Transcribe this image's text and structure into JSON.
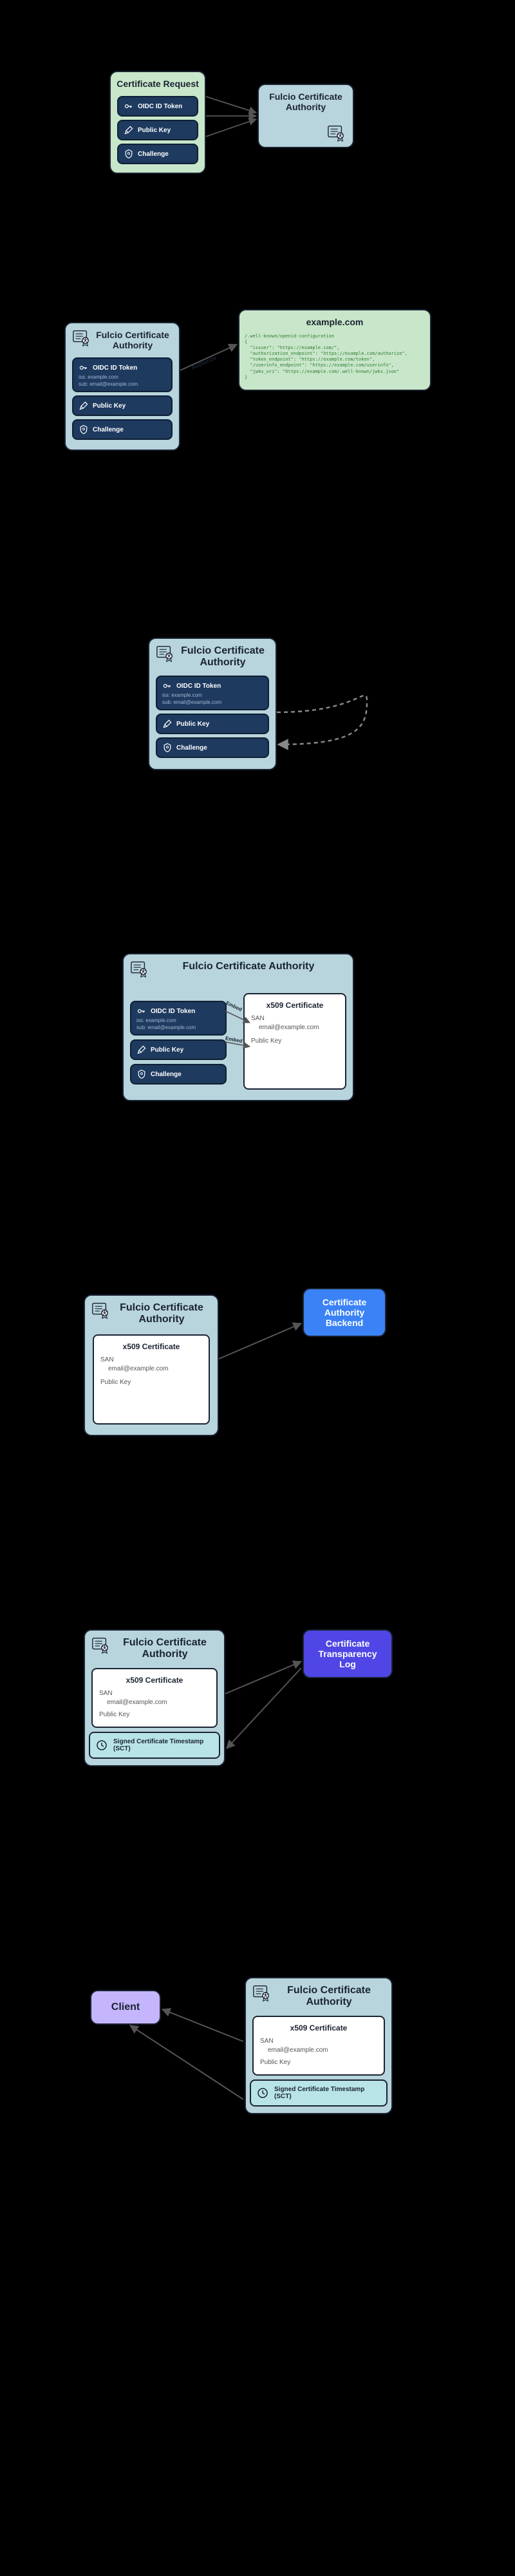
{
  "s1": {
    "req_title": "Certificate Request",
    "oidc": "OIDC ID Token",
    "pubkey": "Public Key",
    "challenge": "Challenge",
    "fca_title": "Fulcio Certificate Authority"
  },
  "s2": {
    "fca_title": "Fulcio Certificate Authority",
    "oidc": "OIDC ID Token",
    "iss": "iss: example.com",
    "sub": "sub: email@example.com",
    "pubkey": "Public Key",
    "challenge": "Challenge",
    "arrow_label": "Authorize",
    "openid_title": "example.com",
    "openid_code": "/.well-known/openid-configuration\n{\n  \"issuer\": \"https://example.com/\",\n  \"authorization_endpoint\": \"https://example.com/authorize\",\n  \"token_endpoint\": \"https://example.com/token\",\n  \"/userinfo_endpoint\": \"https://example.com/userinfo\",\n  \"jwks_uri\": \"https://example.com/.well-known/jwks.json\"\n}"
  },
  "s3": {
    "fca_title": "Fulcio Certificate Authority",
    "oidc": "OIDC ID Token",
    "iss": "iss: example.com",
    "sub": "sub: email@example.com",
    "pubkey": "Public Key",
    "challenge": "Challenge"
  },
  "s4": {
    "fca_title": "Fulcio Certificate Authority",
    "oidc": "OIDC ID Token",
    "iss": "iss: example.com",
    "sub": "sub: email@example.com",
    "pubkey": "Public Key",
    "challenge": "Challenge",
    "embed1": "Embed",
    "embed2": "Embed",
    "x509_title": "x509 Certificate",
    "san_label": "SAN",
    "san_value": "email@example.com",
    "pk_label": "Public Key"
  },
  "s5": {
    "fca_title": "Fulcio Certificate Authority",
    "x509_title": "x509 Certificate",
    "san_label": "SAN",
    "san_value": "email@example.com",
    "pk_label": "Public Key",
    "cab_title": "Certificate Authority Backend"
  },
  "s6": {
    "fca_title": "Fulcio Certificate Authority",
    "x509_title": "x509 Certificate",
    "san_label": "SAN",
    "san_value": "email@example.com",
    "pk_label": "Public Key",
    "sct": "Signed Certificate Timestamp (SCT)",
    "ctl_title": "Certificate Transparency Log"
  },
  "s7": {
    "client": "Client",
    "fca_title": "Fulcio Certificate Authority",
    "x509_title": "x509 Certificate",
    "san_label": "SAN",
    "san_value": "email@example.com",
    "pk_label": "Public Key",
    "sct": "Signed Certificate Timestamp (SCT)"
  }
}
